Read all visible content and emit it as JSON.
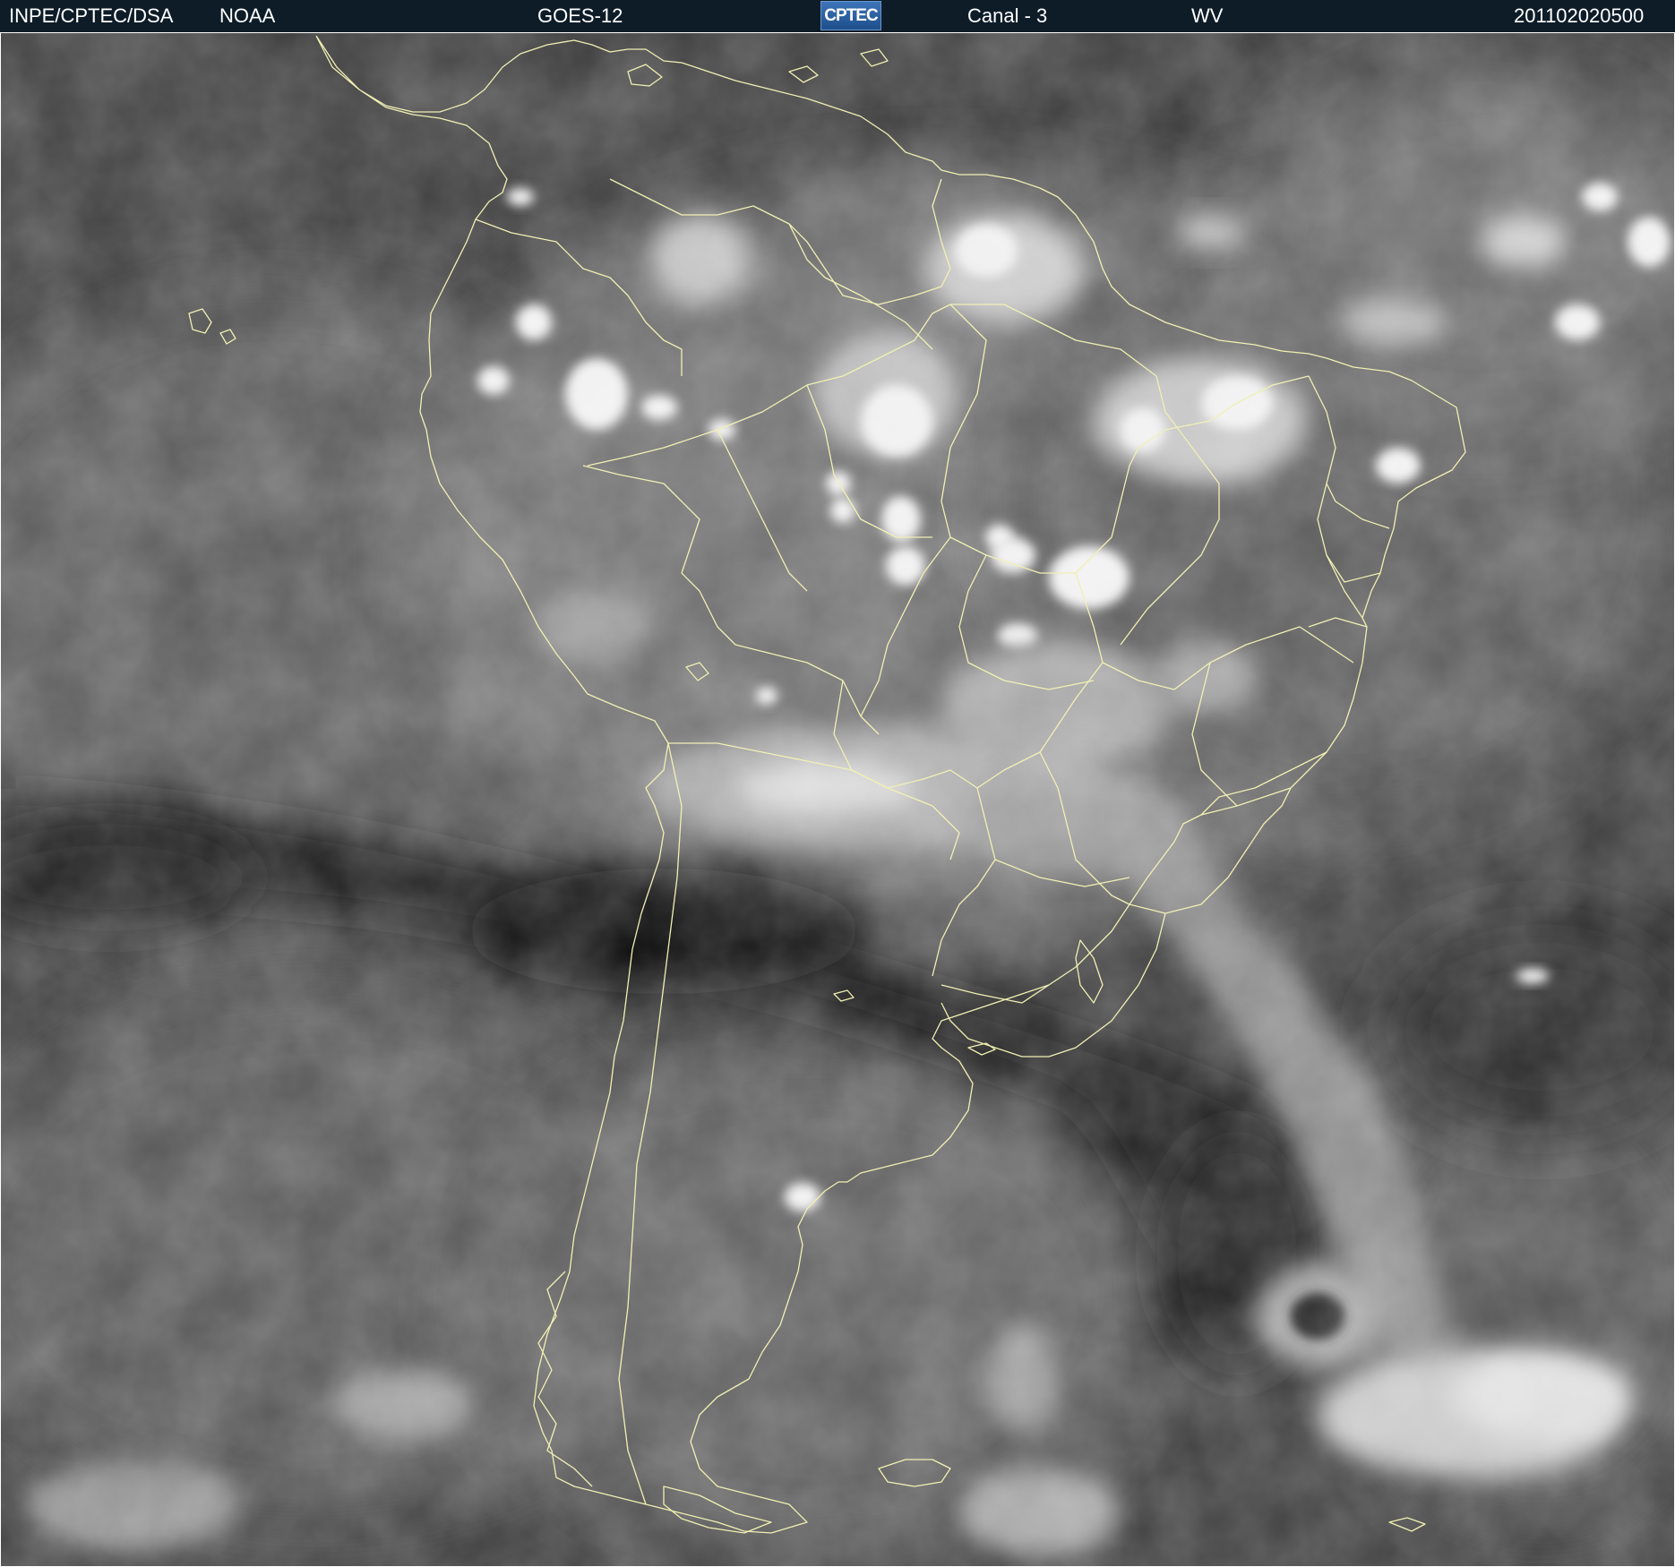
{
  "header": {
    "agency": "INPE/CPTEC/DSA",
    "provider": "NOAA",
    "satellite": "GOES-12",
    "logo_text": "CPTEC",
    "channel": "Canal - 3",
    "band": "WV",
    "timestamp": "201102020500"
  },
  "image": {
    "type": "water-vapor satellite image",
    "region": "South America",
    "palette": "grayscale",
    "border_color": "#f0f0b4",
    "header_bg": "#0e1c28"
  }
}
